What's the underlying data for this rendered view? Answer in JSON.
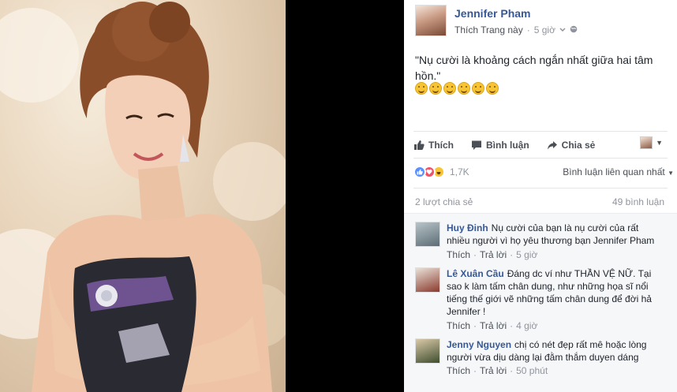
{
  "post": {
    "author": "Jennifer Pham",
    "like_page": "Thích Trang này",
    "separator": "·",
    "time": "5 giờ",
    "text": "\"Nụ cười là khoảng cách ngắn nhất giữa hai tâm hồn.\"",
    "emoji_count": 6
  },
  "actions": {
    "like": "Thích",
    "comment": "Bình luận",
    "share": "Chia sẻ"
  },
  "reactions": {
    "count": "1,7K",
    "sort_label": "Bình luận liên quan nhất"
  },
  "stats": {
    "shares": "2 lượt chia sẻ",
    "comments": "49 bình luận"
  },
  "comments": [
    {
      "name": "Huy Đinh",
      "text": "Nụ cười của bạn là nụ cười của rất nhiều người vì họ yêu thương bạn Jennifer Pham",
      "like": "Thích",
      "reply": "Trả lời",
      "time": "5 giờ"
    },
    {
      "name": "Lê Xuân Cầu",
      "text": "Đáng dc ví như THẦN VỆ NỮ. Tại sao k làm tấm chân dung, như những họa sĩ nổi tiếng thế giới vẽ những tấm chân dung để đời hả Jennifer !",
      "like": "Thích",
      "reply": "Trả lời",
      "time": "4 giờ"
    },
    {
      "name": "Jenny Nguyen",
      "text": "chị có nét đẹp rất mê hoặc lòng người vừa dịu dàng lại đằm thắm duyen dáng",
      "like": "Thích",
      "reply": "Trả lời",
      "time": "50 phút"
    }
  ],
  "colors": {
    "link": "#365899",
    "muted": "#90949c",
    "like_reaction": "#5890ff",
    "love_reaction": "#f25268",
    "haha_reaction": "#f7c533"
  },
  "icons": [
    "thumbs-up-icon",
    "comment-bubble-icon",
    "share-arrow-icon",
    "globe-icon",
    "chevron-down-icon"
  ]
}
